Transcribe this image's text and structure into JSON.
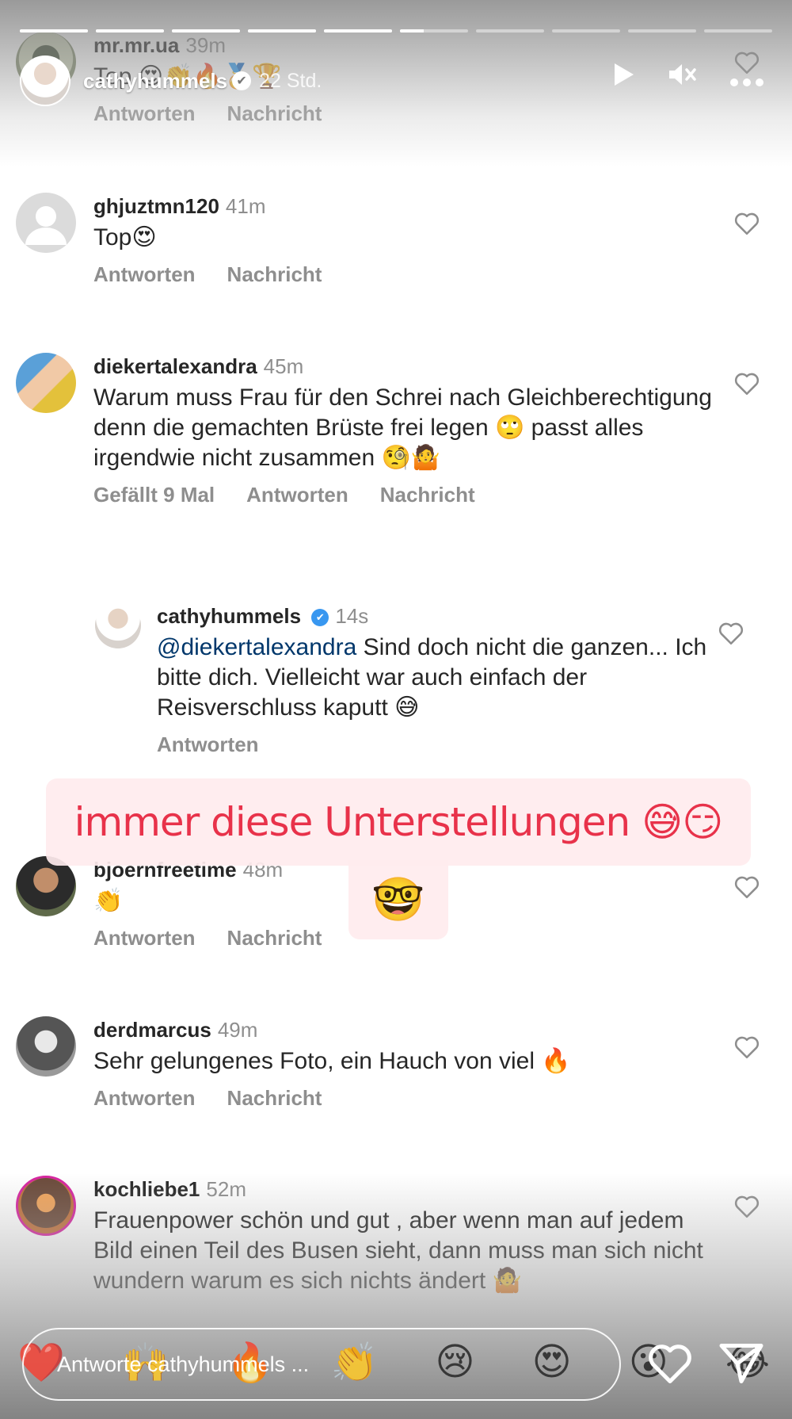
{
  "story": {
    "username": "cathyhummels",
    "verified_mark": "✔",
    "time": "22 Std.",
    "progress_segments": [
      1,
      1,
      1,
      1,
      1,
      0.35,
      0,
      0,
      0,
      0
    ],
    "icons": {
      "play": "play-icon",
      "mute": "mute-icon",
      "more": "more-icon"
    }
  },
  "comments": [
    {
      "username": "mr.mr.ua",
      "time": "39m",
      "text": "Top",
      "emoji": "😍👏🔥🏅🏆",
      "actions": [
        "Antworten",
        "Nachricht"
      ]
    },
    {
      "username": "ghjuztmn120",
      "time": "41m",
      "text": "Top😍",
      "actions": [
        "Antworten",
        "Nachricht"
      ]
    },
    {
      "username": "diekertalexandra",
      "time": "45m",
      "text": "Warum muss Frau für den Schrei nach Gleichberechtigung denn die gemachten Brüste frei legen 🙄 passt alles irgendwie nicht zusammen 🧐🤷",
      "actions": [
        "Gefällt 9 Mal",
        "Antworten",
        "Nachricht"
      ]
    },
    {
      "username": "bjoernfreetime",
      "time": "48m",
      "text": "👏",
      "actions": [
        "Antworten",
        "Nachricht"
      ]
    },
    {
      "username": "derdmarcus",
      "time": "49m",
      "text": "Sehr gelungenes Foto, ein Hauch von viel 🔥",
      "actions": [
        "Antworten",
        "Nachricht"
      ]
    },
    {
      "username": "kochliebe1",
      "time": "52m",
      "text": "Frauenpower schön und gut , aber wenn man auf jedem Bild einen Teil des Busen sieht, dann muss man sich nicht wundern warum es sich nichts ändert 🤷"
    }
  ],
  "reply": {
    "username": "cathyhummels",
    "verified_mark": "✔",
    "time": "14s",
    "mention": "@diekertalexandra",
    "text": " Sind doch nicht die ganzen... Ich bitte dich. Vielleicht war auch einfach der Reisverschluss kaputt 😅",
    "actions": [
      "Antworten"
    ]
  },
  "overlay": {
    "caption": "immer diese Unterstellungen 😅😏",
    "emoji_sticker": "🤓",
    "caption_color": "#e8324a"
  },
  "bottom_bar": {
    "input_placeholder": "Antworte cathyhummels ...",
    "quick_reactions": [
      "❤️",
      "🙌",
      "🔥",
      "👏",
      "😢",
      "😍",
      "😮",
      "😂"
    ],
    "icons": {
      "like": "heart-icon",
      "send": "send-icon"
    }
  }
}
